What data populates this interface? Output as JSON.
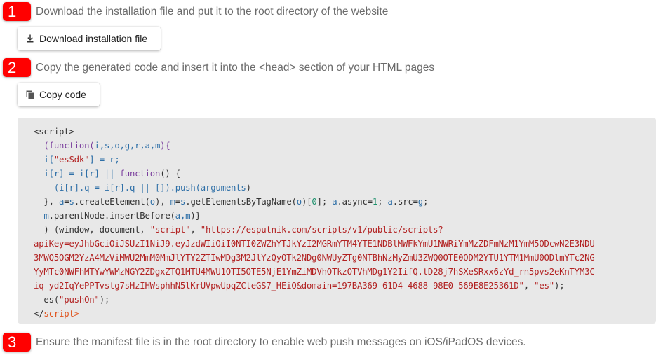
{
  "steps": [
    {
      "number": "1",
      "text": "Download the installation file and put it to the root directory of the website"
    },
    {
      "number": "2",
      "text": "Copy the generated code and insert it into the <head> section of your HTML pages"
    },
    {
      "number": "3",
      "text": "Ensure the manifest file is in the root directory to enable web push messages on iOS/iPadOS devices."
    }
  ],
  "buttons": {
    "download": {
      "label": "Download installation file",
      "icon": "download-icon"
    },
    "copy": {
      "label": "Copy code",
      "icon": "copy-icon"
    }
  },
  "code": {
    "open_tag": "<script>",
    "l1_a": "(",
    "l1_kw": "function",
    "l1_b": "(",
    "l1_params": "i,s,o,g,r,a,m",
    "l1_c": "){",
    "l2_a": "i[",
    "l2_str": "\"esSdk\"",
    "l2_b": "] = ",
    "l2_r": "r",
    "l2_c": ";",
    "l3_a": "i[",
    "l3_r1": "r",
    "l3_b": "] = i[",
    "l3_r2": "r",
    "l3_c": "] || ",
    "l3_kw": "function",
    "l3_d": "() {",
    "l4_a": "(i[",
    "l4_r1": "r",
    "l4_b": "].q = i[",
    "l4_r2": "r",
    "l4_c": "].q || []).push(",
    "l4_args": "arguments",
    "l4_d": ")",
    "l5_a": "}, ",
    "l5_av": "a",
    "l5_b": "=",
    "l5_s": "s",
    "l5_c": ".createElement(",
    "l5_o": "o",
    "l5_d": "), ",
    "l5_mv": "m",
    "l5_e": "=",
    "l5_s2": "s",
    "l5_f": ".getElementsByTagName(",
    "l5_o2": "o",
    "l5_g": ")[",
    "l5_zero": "0",
    "l5_h": "]; ",
    "l5_a2": "a",
    "l5_i": ".async=",
    "l5_one": "1",
    "l5_j": "; ",
    "l5_a3": "a",
    "l5_k": ".src=",
    "l5_g2": "g",
    "l5_l": ";",
    "l6_m": "m",
    "l6_a": ".parentNode.insertBefore(",
    "l6_args": "a,m",
    "l6_b": ")}",
    "l7_a": ") (window, document, ",
    "l7_str1": "\"script\"",
    "l7_b": ", ",
    "l7_str2": "\"https://esputnik.com/scripts/v1/public/scripts?",
    "l8": "apiKey=eyJhbGciOiJSUzI1NiJ9.eyJzdWIiOiI0NTI0ZWZhYTJkYzI2MGRmYTM4YTE1NDBlMWFkYmU1NWRiYmMzZDFmNzM1YmM5ODcwN2E3NDU",
    "l9": "3MWQ5OGM2YzA4MzViMWU2MmM0MmJlYTY2ZTIwMDg3M2JlYzQyOTk2NDg0NWUyZTg0NTBhNzMyZmU3ZWQ0OTE0ODM2YTU1YTM1MmU0ODlmYTc2NG",
    "l10": "YyMTc0NWFhMTYwYWMzNGY2ZDgxZTQ1MTU4MWU1OTI5OTE5NjE1YmZiMDVhOTkzOTVhMDg1Y2IifQ.tD28j7hSXeSRxx6zYd_rn5pvs2eKnTYM3C",
    "l11_str": "iq-yd2IqYePPTvstg7sHzIHWsphhN5lKrUVpwUpqZCteGS7_HEiQ&domain=197BA369-61D4-4688-98E0-569E8E25361D\"",
    "l11_a": ", ",
    "l11_str2": "\"es\"",
    "l11_b": ");",
    "l12_a": "es(",
    "l12_str": "\"pushOn\"",
    "l12_b": ");",
    "close_lt": "</",
    "close_tag": "script",
    "close_gt": ">"
  },
  "colors": {
    "badge": "#ff0000",
    "code_bg": "#e8e8e8",
    "keyword": "#7a3e9d",
    "variable": "#2e6fa7",
    "string": "#b22222",
    "number": "#1a8f6a",
    "tag": "#e0531c"
  }
}
